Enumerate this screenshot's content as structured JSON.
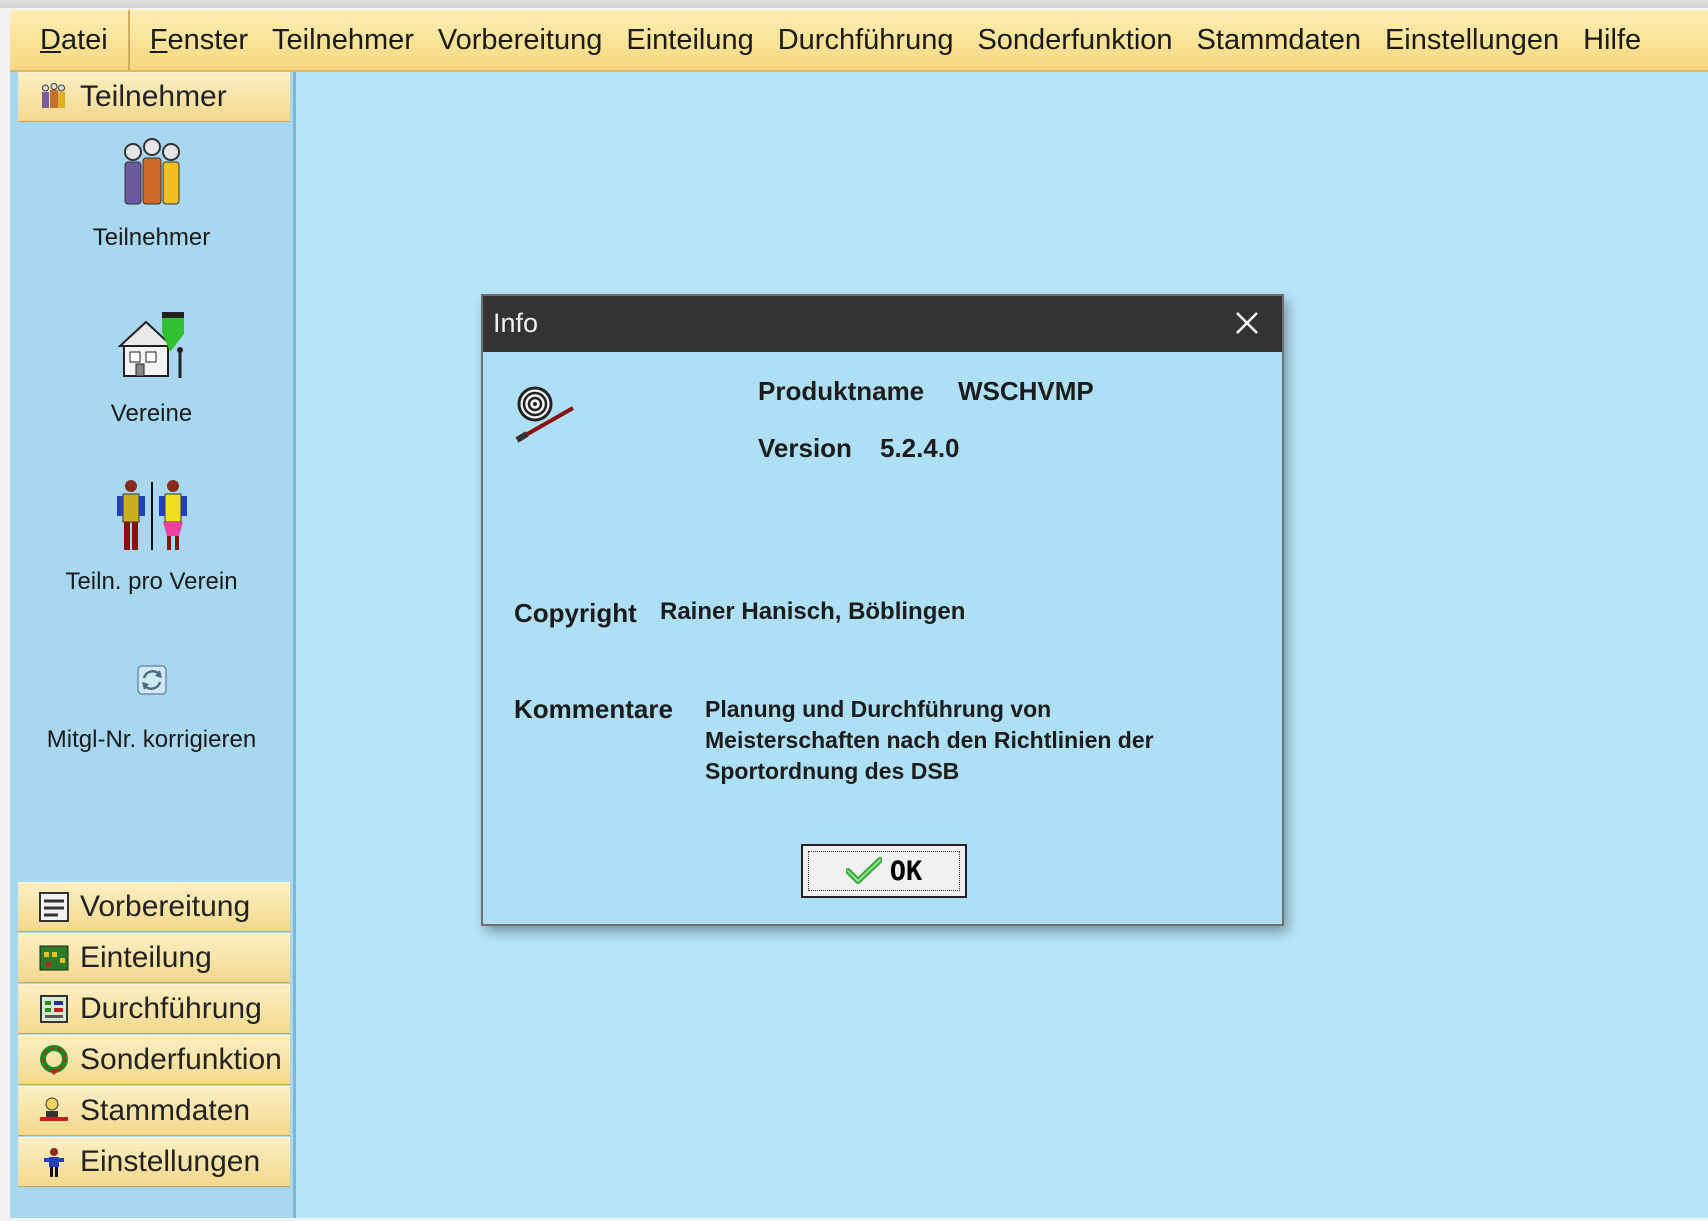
{
  "menu": {
    "items": [
      "Datei",
      "Fenster",
      "Teilnehmer",
      "Vorbereitung",
      "Einteilung",
      "Durchführung",
      "Sonderfunktion",
      "Stammdaten",
      "Einstellungen",
      "Hilfe"
    ]
  },
  "sidebar": {
    "active_group": "Teilnehmer",
    "entries": [
      {
        "label": "Teilnehmer",
        "icon": "participants-icon"
      },
      {
        "label": "Vereine",
        "icon": "clubs-house-icon"
      },
      {
        "label": "Teiln. pro Verein",
        "icon": "members-per-club-icon"
      },
      {
        "label": "Mitgl-Nr. korrigieren",
        "icon": "refresh-icon"
      }
    ],
    "groups": [
      {
        "label": "Vorbereitung",
        "icon": "preparation-icon"
      },
      {
        "label": "Einteilung",
        "icon": "grid-assignment-icon"
      },
      {
        "label": "Durchführung",
        "icon": "scoresheet-icon"
      },
      {
        "label": "Sonderfunktion",
        "icon": "wreath-icon"
      },
      {
        "label": "Stammdaten",
        "icon": "person-desk-icon"
      },
      {
        "label": "Einstellungen",
        "icon": "settings-person-icon"
      }
    ]
  },
  "dialog": {
    "title": "Info",
    "product_label": "Produktname",
    "product_value": "WSCHVMP",
    "version_label": "Version",
    "version_value": "5.2.4.0",
    "copyright_label": "Copyright",
    "copyright_value": "Rainer Hanisch, Böblingen",
    "comments_label": "Kommentare",
    "comments_lines": [
      "Planung und Durchführung von",
      "Meisterschaften nach den Richtlinien der",
      "Sportordnung des DSB"
    ],
    "ok_label": "OK"
  },
  "colors": {
    "menubar": "#f5d97f",
    "sidebar": "#a7d8ef",
    "workspace": "#b7e6f9",
    "dialog_bg": "#aee0f5",
    "titlebar": "#333333"
  }
}
